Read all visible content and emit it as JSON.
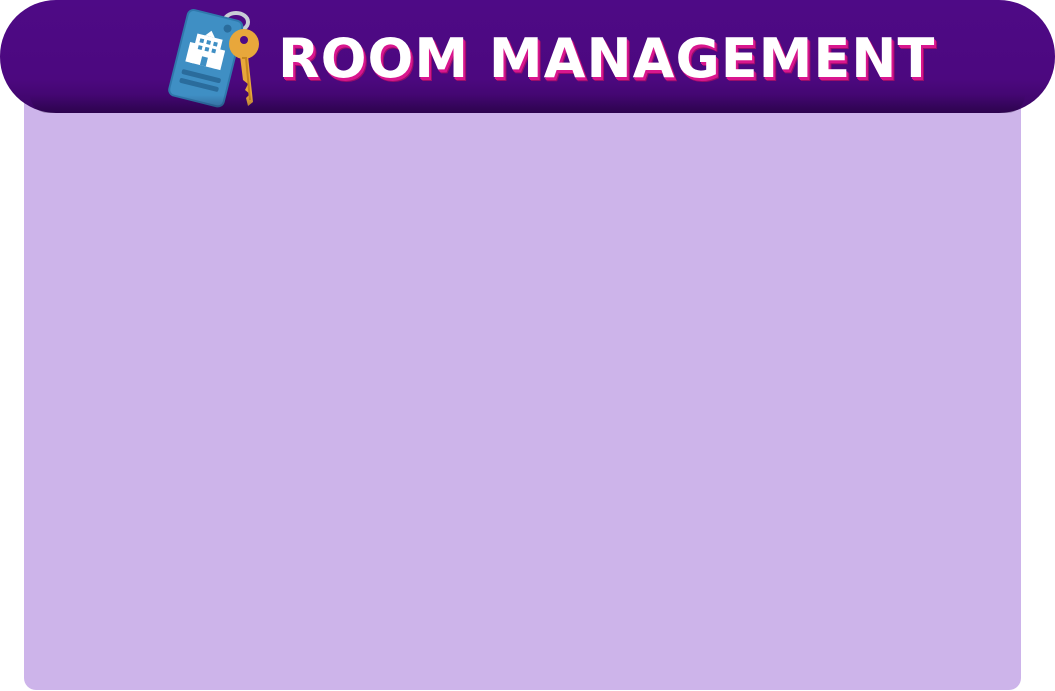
{
  "header": {
    "title": "ROOM MANAGEMENT",
    "icon": "hotel-key-tag-icon"
  },
  "colors": {
    "header_background": "#4e0a86",
    "panel_background": "#cdb4ea",
    "title_text": "#ffffff",
    "title_shadow": "#d9168e",
    "key_tag": "#3f8fc4",
    "key": "#e8a73b"
  }
}
